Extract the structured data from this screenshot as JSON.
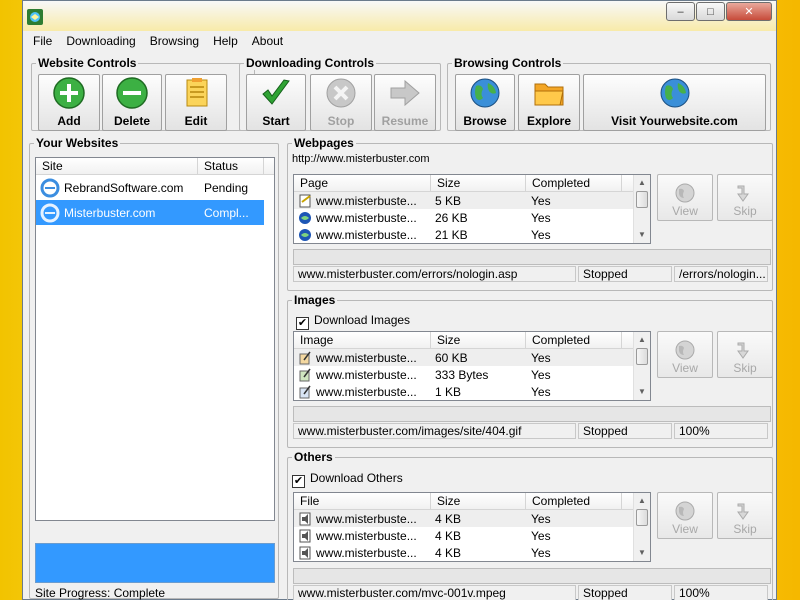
{
  "menu": [
    "File",
    "Downloading",
    "Browsing",
    "Help",
    "About"
  ],
  "window_buttons": {
    "minimize": "–",
    "maximize": "□",
    "close": "✕"
  },
  "website_controls": {
    "title": "Website Controls",
    "add": "Add",
    "delete": "Delete",
    "edit": "Edit"
  },
  "downloading_controls": {
    "title": "Downloading Controls",
    "start": "Start",
    "stop": "Stop",
    "resume": "Resume"
  },
  "browsing_controls": {
    "title": "Browsing Controls",
    "browse": "Browse",
    "explore": "Explore",
    "visit": "Visit Yourwebsite.com"
  },
  "your_websites": {
    "title": "Your Websites",
    "columns": [
      "Site",
      "Status"
    ],
    "rows": [
      {
        "site": "RebrandSoftware.com",
        "status": "Pending"
      },
      {
        "site": "Misterbuster.com",
        "status": "Compl..."
      }
    ],
    "site_progress": "Site Progress: Complete"
  },
  "webpages": {
    "title": "Webpages",
    "url": "http://www.misterbuster.com",
    "columns": [
      "Page",
      "Size",
      "Completed"
    ],
    "rows": [
      {
        "name": "www.misterbuste...",
        "size": "5 KB",
        "completed": "Yes"
      },
      {
        "name": "www.misterbuste...",
        "size": "26 KB",
        "completed": "Yes"
      },
      {
        "name": "www.misterbuste...",
        "size": "21 KB",
        "completed": "Yes"
      }
    ],
    "status": [
      "www.misterbuster.com/errors/nologin.asp",
      "Stopped",
      "/errors/nologin..."
    ],
    "view": "View",
    "skip": "Skip"
  },
  "images": {
    "title": "Images",
    "checkbox": "Download Images",
    "columns": [
      "Image",
      "Size",
      "Completed"
    ],
    "rows": [
      {
        "name": "www.misterbuste...",
        "size": "60 KB",
        "completed": "Yes"
      },
      {
        "name": "www.misterbuste...",
        "size": "333 Bytes",
        "completed": "Yes"
      },
      {
        "name": "www.misterbuste...",
        "size": "1 KB",
        "completed": "Yes"
      }
    ],
    "status": [
      "www.misterbuster.com/images/site/404.gif",
      "Stopped",
      "100%"
    ],
    "view": "View",
    "skip": "Skip"
  },
  "others": {
    "title": "Others",
    "checkbox": "Download Others",
    "columns": [
      "File",
      "Size",
      "Completed"
    ],
    "rows": [
      {
        "name": "www.misterbuste...",
        "size": "4 KB",
        "completed": "Yes"
      },
      {
        "name": "www.misterbuste...",
        "size": "4 KB",
        "completed": "Yes"
      },
      {
        "name": "www.misterbuste...",
        "size": "4 KB",
        "completed": "Yes"
      }
    ],
    "status": [
      "www.misterbuster.com/mvc-001v.mpeg",
      "Stopped",
      "100%"
    ],
    "view": "View",
    "skip": "Skip"
  },
  "colors": {
    "selection": "#3399ff",
    "progress_fill": "#3399ff",
    "accent_green": "#2fa334"
  }
}
